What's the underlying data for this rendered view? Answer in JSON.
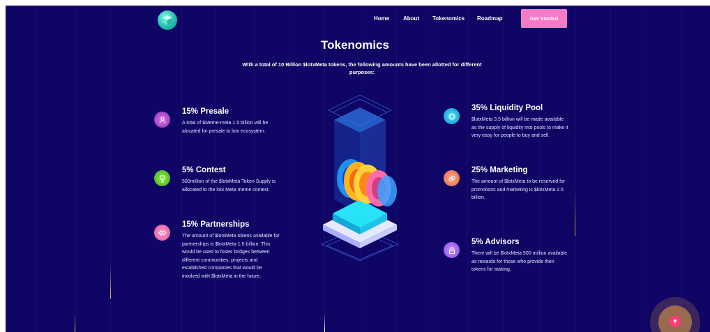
{
  "nav": {
    "links": [
      "Home",
      "About",
      "Tokenomics",
      "Roadmap"
    ],
    "cta_label": "Get Started"
  },
  "section": {
    "title": "Tokenomics",
    "subtitle": "With a total of 10 Billion $lotxMeta tokens, the following amounts have been allotted for different purposes:"
  },
  "allocations_left": [
    {
      "title": "15% Presale",
      "text": "A total of $Meme-meta 1.5 billion will be alocated for presale to lotx ecosystem.",
      "icon": "user-icon",
      "color": "#b14cd6"
    },
    {
      "title": "5% Contest",
      "text": "500million of the $lotxMeta Token Supply is allocated to the lotx Meta meme contest.",
      "icon": "trophy-icon",
      "color": "#5fd12c"
    },
    {
      "title": "15% Partnerships",
      "text": "The amount of $lotxMeta tokens available for partnerships is $lotxMeta 1.5 billion. This would be used to foster bridges between different communities, projects and established companies that would be involved with $lotxMeta in the future.",
      "icon": "handshake-icon",
      "color": "#f06fb0"
    }
  ],
  "allocations_right": [
    {
      "title": "35% Liquidity Pool",
      "text": "$lotxMeta 3.5 billion will be made available as the supply of liquidity into pools to make it very easy for people to buy and sell.",
      "icon": "chip-icon",
      "color": "#10c6ee"
    },
    {
      "title": "25% Marketing",
      "text": "The amount of $lotxMeta to be reserved for promotions and marketing is $lotxMeta 2.5 billion.",
      "icon": "coins-icon",
      "color": "#f2835f"
    },
    {
      "title": "5% Advisors",
      "text": "There will be $lotxMeta 500 million available as rewards for those who provide their tokens for staking.",
      "icon": "lock-icon",
      "color": "#a968f2"
    }
  ],
  "scroll_top_icon": "arrow-up-icon"
}
